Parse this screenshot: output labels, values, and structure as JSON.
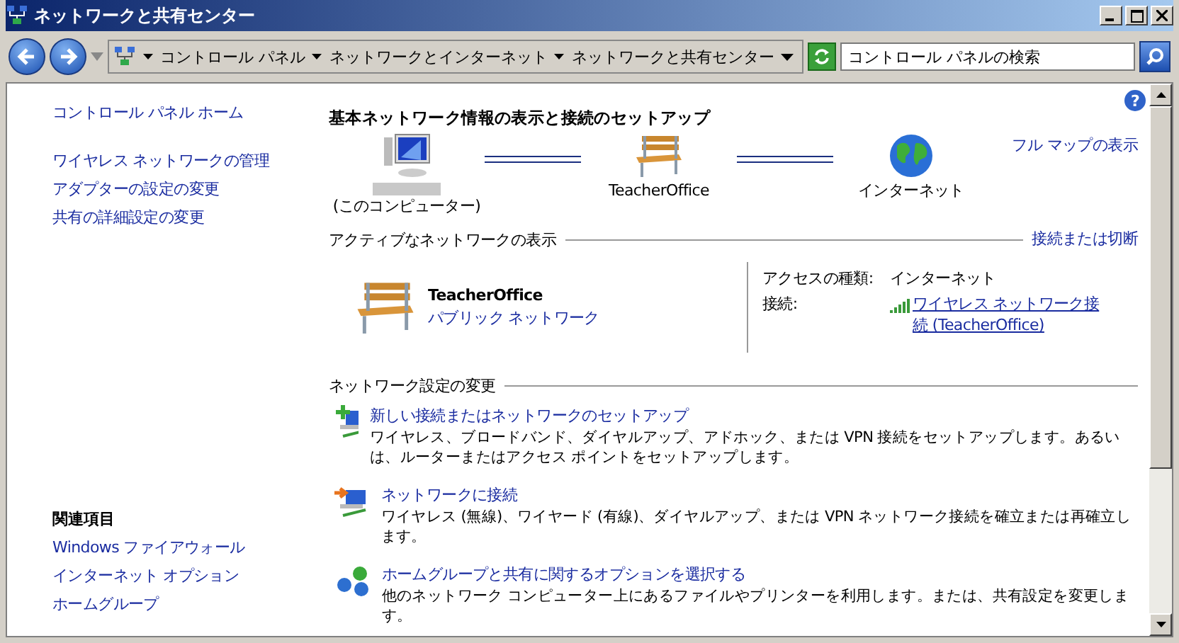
{
  "window": {
    "title": "ネットワークと共有センター"
  },
  "address": {
    "crumbs": [
      "コントロール パネル",
      "ネットワークとインターネット",
      "ネットワークと共有センター"
    ],
    "search_placeholder": "コントロール パネルの検索"
  },
  "sidebar": {
    "home": "コントロール パネル ホーム",
    "links": [
      "ワイヤレス ネットワークの管理",
      "アダプターの設定の変更",
      "共有の詳細設定の変更"
    ],
    "related_heading": "関連項目",
    "related": [
      "Windows ファイアウォール",
      "インターネット オプション",
      "ホームグループ"
    ]
  },
  "main": {
    "help": "?",
    "heading": "基本ネットワーク情報の表示と接続のセットアップ",
    "map": {
      "nodes": [
        {
          "kind": "computer",
          "label": "(このコンピューター)"
        },
        {
          "kind": "bench",
          "label": "TeacherOffice"
        },
        {
          "kind": "globe",
          "label": "インターネット"
        }
      ],
      "full_map_link": "フル マップの表示"
    },
    "active": {
      "title": "アクティブなネットワークの表示",
      "action_link": "接続または切断",
      "network_name": "TeacherOffice",
      "network_type": "パブリック ネットワーク",
      "access_label": "アクセスの種類:",
      "access_value": "インターネット",
      "connection_label": "接続:",
      "connection_link": "ワイヤレス ネットワーク接続 (TeacherOffice)"
    },
    "settings": {
      "title": "ネットワーク設定の変更",
      "tasks": [
        {
          "kind": "new",
          "title": "新しい接続またはネットワークのセットアップ",
          "description": "ワイヤレス、ブロードバンド、ダイヤルアップ、アドホック、または VPN 接続をセットアップします。あるいは、ルーターまたはアクセス ポイントをセットアップします。"
        },
        {
          "kind": "connect",
          "title": "ネットワークに接続",
          "description": "ワイヤレス (無線)、ワイヤード (有線)、ダイヤルアップ、または VPN ネットワーク接続を確立または再確立します。"
        },
        {
          "kind": "homegroup",
          "title": "ホームグループと共有に関するオプションを選択する",
          "description": "他のネットワーク コンピューター上にあるファイルやプリンターを利用します。または、共有設定を変更します。"
        }
      ]
    }
  }
}
